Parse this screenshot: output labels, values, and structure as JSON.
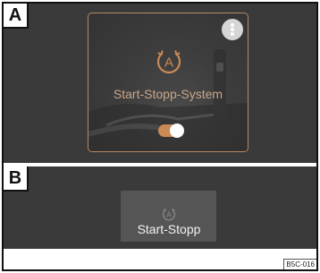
{
  "panels": {
    "a": {
      "label": "A",
      "tile": {
        "title": "Start-Stopp-System",
        "icon": "auto-start-stop-icon",
        "menu_icon": "more-vertical-icon",
        "toggle_state": "on"
      }
    },
    "b": {
      "label": "B",
      "tile": {
        "title": "Start-Stopp",
        "icon": "auto-start-stop-icon"
      }
    }
  },
  "footer": {
    "code": "B5C-016"
  },
  "colors": {
    "panel_bg": "#3a3a3a",
    "accent": "#c98a55",
    "tile_border": "#b78a63",
    "tile_b_bg": "#555555"
  }
}
